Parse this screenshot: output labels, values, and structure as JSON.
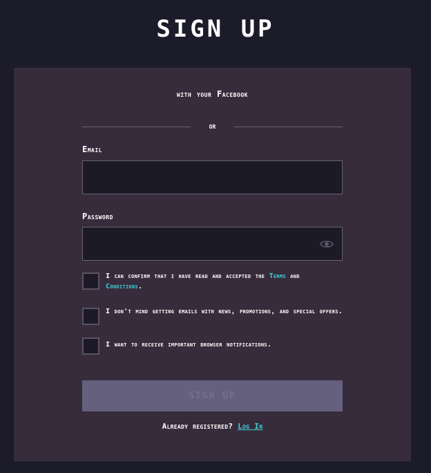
{
  "header": {
    "title": "SIGN UP"
  },
  "form": {
    "facebook_text": "with your Facebook",
    "divider_text": "or",
    "email": {
      "label": "Email",
      "value": "",
      "placeholder": ""
    },
    "password": {
      "label": "Password",
      "value": "",
      "placeholder": ""
    },
    "checkboxes": [
      {
        "text_before": "I can confirm that i have read and accepted the ",
        "link_text": "Terms and Conditions",
        "link_part_1": "Terms",
        "middle_text": " and ",
        "link_part_2": "Conditions",
        "text_after": ".",
        "checked": false
      },
      {
        "text": "I don't mind getting emails with news, promotions, and special offers.",
        "checked": false
      },
      {
        "text": "I want to receive important browser notifications.",
        "checked": false
      }
    ],
    "submit_label": "SIGN UP",
    "already_text": "Already registered?",
    "login_link": "Log In"
  },
  "colors": {
    "page_background": "#1b1b29",
    "card_background": "#372c3b",
    "input_background": "#1c1a27",
    "accent_link": "#3fd0d8",
    "button_disabled": "#66607f"
  },
  "icons": {
    "password_toggle": "eye-icon"
  }
}
